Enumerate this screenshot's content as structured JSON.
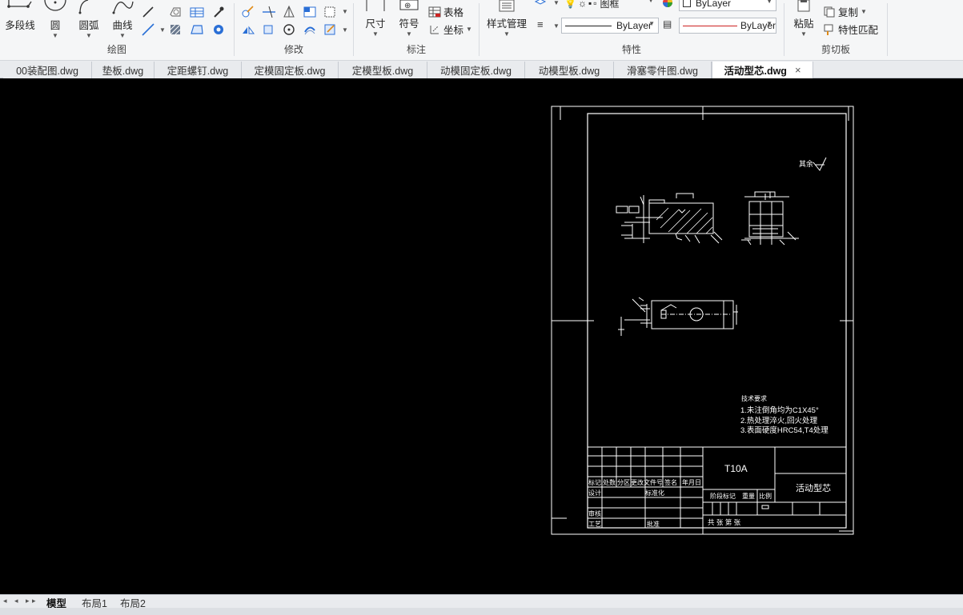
{
  "ribbon": {
    "draw": {
      "title": "绘图",
      "polyline": "多段线",
      "circle": "圆",
      "arc": "圆弧",
      "curve": "曲线"
    },
    "modify": {
      "title": "修改"
    },
    "annotate": {
      "title": "标注",
      "dimension": "尺寸",
      "symbol": "符号",
      "table": "表格",
      "coordinate": "坐标"
    },
    "properties": {
      "title": "特性",
      "style_manager": "样式管理",
      "layer_name": "图框",
      "color_value": "ByLayer",
      "linetype_value": "ByLayer",
      "lineweight_value": "ByLayer"
    },
    "clipboard": {
      "title": "剪切板",
      "paste": "粘贴",
      "copy": "复制",
      "match_properties": "特性匹配"
    }
  },
  "tabs": [
    {
      "label": "00装配图.dwg"
    },
    {
      "label": "垫板.dwg"
    },
    {
      "label": "定距螺钉.dwg"
    },
    {
      "label": "定模固定板.dwg"
    },
    {
      "label": "定模型板.dwg"
    },
    {
      "label": "动模固定板.dwg"
    },
    {
      "label": "动模型板.dwg"
    },
    {
      "label": "滑塞零件图.dwg"
    },
    {
      "label": "活动型芯.dwg",
      "active": true,
      "close": "×"
    }
  ],
  "drawing": {
    "roughness_note": "其余",
    "tech_req_title": "技术要求",
    "tech_req": [
      "1.未注倒角均为C1X45°",
      "2.热处理淬火,回火处理",
      "3.表面硬度HRC54,T4处理"
    ],
    "material": "T10A",
    "part_name": "活动型芯",
    "title_block": {
      "mark": "标记",
      "count": "处数",
      "zone": "分区",
      "change_doc": "更改文件号",
      "signature": "签名",
      "date": "年月日",
      "design": "设计",
      "standardize": "标准化",
      "review": "审核",
      "process": "工艺",
      "approve": "批准",
      "stage_mark": "阶段标记",
      "weight": "重量",
      "scale": "比例",
      "sheets": "共  张 第  张"
    }
  },
  "layout_tabs": [
    {
      "label": "模型",
      "active": true
    },
    {
      "label": "布局1"
    },
    {
      "label": "布局2"
    }
  ],
  "colors": {
    "canvas_bg": "#000000",
    "drawing_line": "#ffffff",
    "accent_red": "#cc2222",
    "ribbon_bg": "#f5f6f7"
  }
}
